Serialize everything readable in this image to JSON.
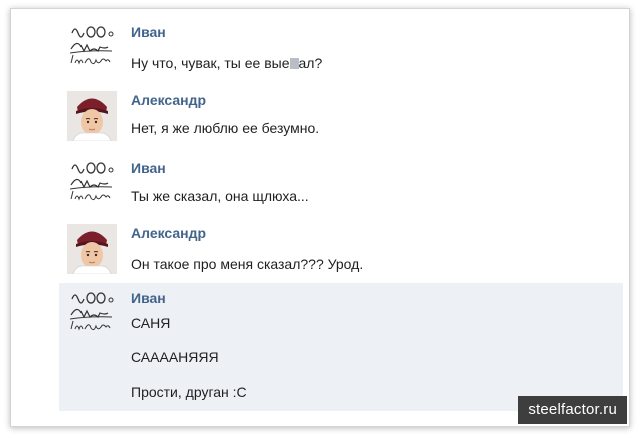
{
  "messages": [
    {
      "sender": "Иван",
      "avatar": "ivan-sketch-avatar",
      "lines": [
        {
          "before": "Ну что, чувак, ты ее вые",
          "after": "ал?"
        }
      ]
    },
    {
      "sender": "Александр",
      "avatar": "alexander-photo-avatar",
      "lines": [
        "Нет, я же люблю ее безумно."
      ]
    },
    {
      "sender": "Иван",
      "avatar": "ivan-sketch-avatar",
      "lines": [
        "Ты же сказал, она щлюха..."
      ]
    },
    {
      "sender": "Александр",
      "avatar": "alexander-photo-avatar",
      "lines": [
        "Он такое про меня сказал??? Урод."
      ]
    },
    {
      "sender": "Иван",
      "avatar": "ivan-sketch-avatar",
      "highlighted": true,
      "lines": [
        "САНЯ",
        "СААААНЯЯЯ",
        "Прости, друган :С"
      ]
    }
  ],
  "watermark": "steelfactor.ru",
  "colors": {
    "sender_name": "#42648b",
    "highlight_bg": "#edf0f5",
    "watermark_bg": "#3e3e3e"
  }
}
